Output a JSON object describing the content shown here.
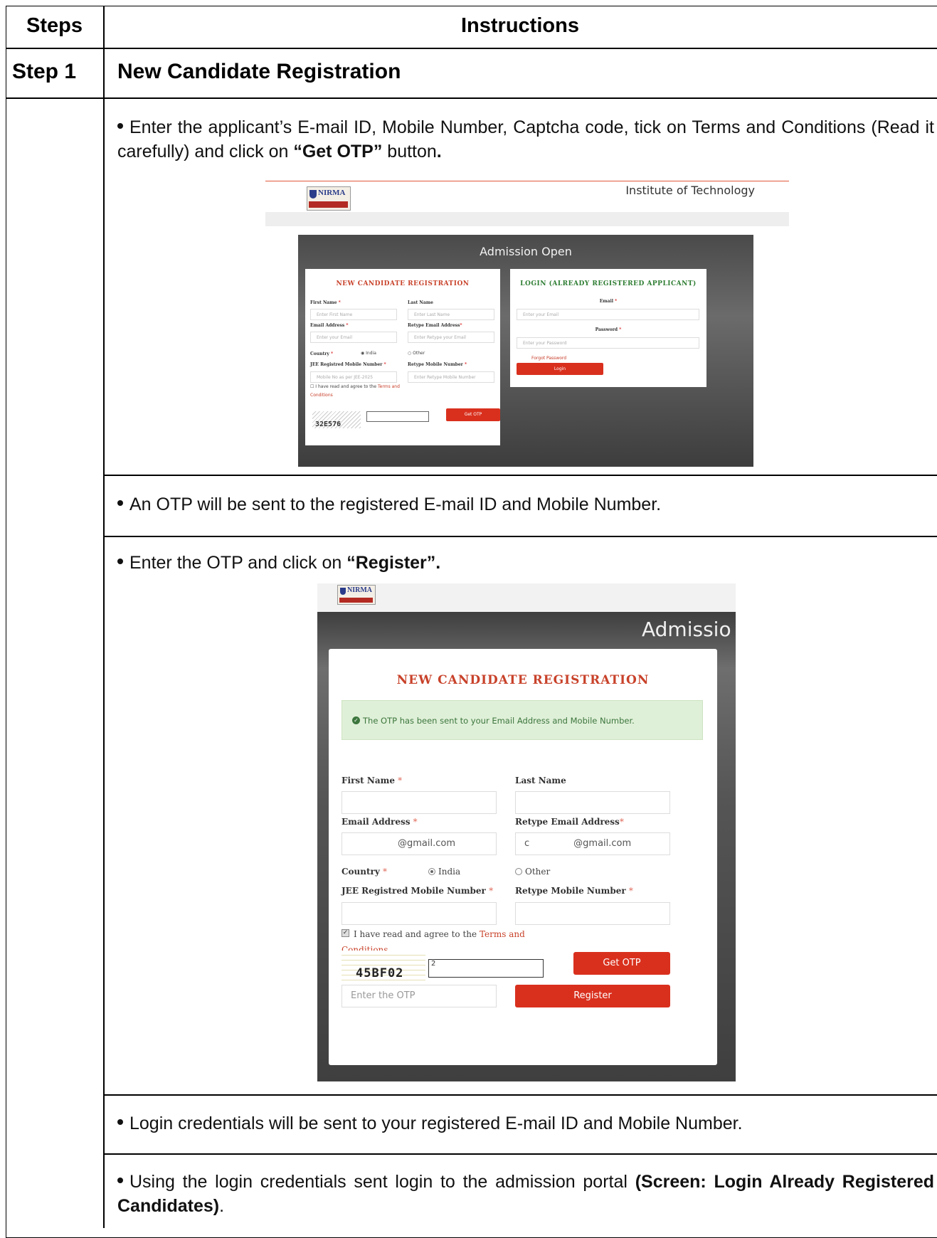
{
  "table": {
    "header_steps": "Steps",
    "header_instructions": "Instructions",
    "step_label": "Step 1",
    "step_title": "New Candidate Registration"
  },
  "bullets": {
    "b1_pre": "Enter the applicant’s E-mail ID, Mobile Number, Captcha code, tick on Terms and Conditions (Read it carefully) and click on ",
    "b1_bold": "“Get OTP”",
    "b1_post": " button",
    "b1_end": ".",
    "b2": "An OTP will be sent to the registered E-mail ID and Mobile Number.",
    "b3_pre": "Enter the OTP and click on ",
    "b3_bold": "“Register”.",
    "b4": "Login credentials will be sent to your registered E-mail ID and Mobile Number.",
    "b5_pre": "Using the login credentials sent login to the admission portal ",
    "b5_bold": "(Screen: Login Already Registered Candidates)",
    "b5_end": "."
  },
  "shot1": {
    "logo_text": "NIRMA",
    "institute": "Institute of Technology",
    "hero_title": "Admission Open",
    "reg": {
      "title": "NEW CANDIDATE REGISTRATION",
      "first_name_label": "First Name",
      "last_name_label": "Last Name",
      "first_name_ph": "Enter First Name",
      "last_name_ph": "Enter Last Name",
      "email_label": "Email Address",
      "retype_email_label": "Retype Email Address",
      "email_ph": "Enter your Email",
      "retype_email_ph": "Enter Retype your Email",
      "country_label": "Country",
      "india": "India",
      "other": "Other",
      "mobile_label": "JEE Registred Mobile Number",
      "retype_mobile_label": "Retype Mobile Number",
      "mobile_ph": "Mobile No as per JEE-2025",
      "retype_mobile_ph": "Enter Retype Mobile Number",
      "agree_text": "I have read and agree to the",
      "terms_link_1": "Terms and",
      "terms_link_2": "Conditions",
      "captcha": "32E576",
      "get_otp": "Get OTP",
      "required_mark": "*"
    },
    "login": {
      "title": "LOGIN (ALREADY REGISTERED APPLICANT)",
      "email_label": "Email",
      "email_ph": "Enter your Email",
      "password_label": "Password",
      "password_ph": "Enter your Password",
      "forgot": "Forgot Password",
      "login_btn": "Login"
    }
  },
  "shot2": {
    "logo_text": "NIRMA",
    "hero_title": "Admissio",
    "title": "NEW CANDIDATE REGISTRATION",
    "alert": "The OTP has been sent to your Email Address and Mobile Number.",
    "first_name_label": "First Name",
    "last_name_label": "Last Name",
    "first_name_val": "",
    "last_name_val": "",
    "email_label": "Email Address",
    "retype_email_label": "Retype Email Address",
    "email_val": "@gmail.com",
    "retype_email_val_prefix": "c",
    "retype_email_val": "@gmail.com",
    "country_label": "Country",
    "india": "India",
    "other": "Other",
    "mobile_label": "JEE Registred Mobile Number",
    "retype_mobile_label": "Retype Mobile Number",
    "agree_text": "I have read and agree to the",
    "terms_link_1": "Terms and",
    "terms_link_2": "Conditions",
    "captcha": "45BF02",
    "captcha_input": "2",
    "get_otp": "Get OTP",
    "otp_ph": "Enter the OTP",
    "register": "Register",
    "required_mark": "*"
  }
}
